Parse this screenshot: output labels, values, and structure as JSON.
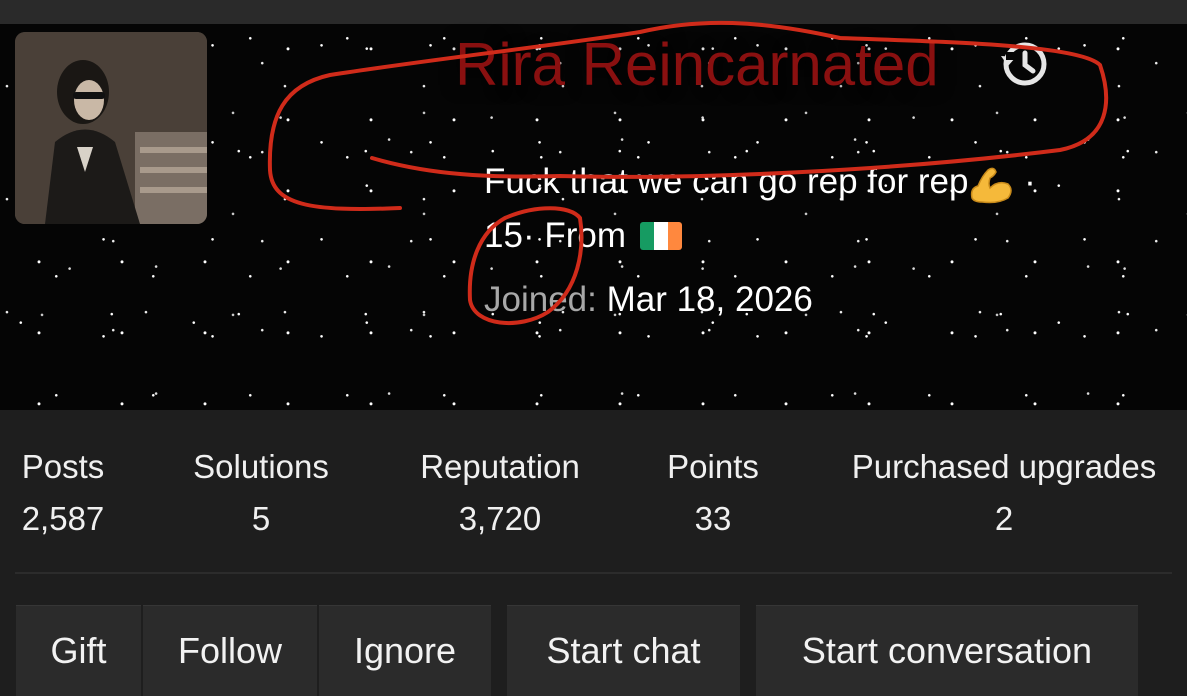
{
  "profile": {
    "username": "Rira Reincarnated",
    "custom_title": "Fuck that we can go rep for rep",
    "title_separator": " ·",
    "age": "15",
    "from_label": " · From",
    "joined_label": "Joined: ",
    "joined_date": "Mar 18, 2026",
    "username_color": "#8a1010"
  },
  "icons": {
    "history": "history-icon",
    "muscle": "flexed-biceps-icon",
    "flag": "ireland-flag-icon"
  },
  "flag_colors": [
    "#169b62",
    "#ffffff",
    "#ff883e"
  ],
  "stats": [
    {
      "label": "Posts",
      "value": "2,587"
    },
    {
      "label": "Solutions",
      "value": "5"
    },
    {
      "label": "Reputation",
      "value": "3,720"
    },
    {
      "label": "Points",
      "value": "33"
    },
    {
      "label": "Purchased upgrades",
      "value": "2"
    }
  ],
  "actions": {
    "gift": "Gift",
    "follow": "Follow",
    "ignore": "Ignore",
    "start_chat": "Start chat",
    "start_conversation": "Start conversation"
  },
  "annotation_color": "#d02b1a"
}
